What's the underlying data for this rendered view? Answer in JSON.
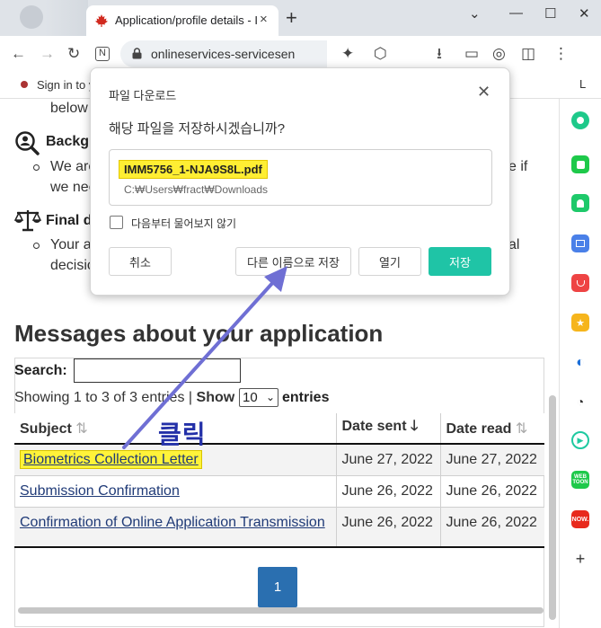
{
  "browser": {
    "tab_title": "Application/profile details - Imm",
    "tab_close": "×",
    "new_tab": "+",
    "url": "onlineservices-servicesen",
    "bookmark_label": "Sign in to y",
    "bookmark_end": "L",
    "window_controls": {
      "chevron": "⌄",
      "minimize": "—",
      "maximize": "☐",
      "close": "✕"
    },
    "toolbar_glyphs": {
      "back": "←",
      "forward": "→",
      "reload": "↻",
      "n_icon": "N",
      "share": "⇪",
      "ext1": "✦",
      "ext2": "⬡",
      "download": "⭳",
      "cast": "▭",
      "screenshot": "◎",
      "panel": "◫",
      "menu": "⋮"
    },
    "icons": [
      "red-maple-leaf-icon",
      "lock-icon",
      "ghost-bird-icon"
    ]
  },
  "page": {
    "partial_below": "below",
    "background_heading": "Backgr",
    "background_text_1": "We are",
    "background_text_1_end": "e if",
    "background_text_2": "we nee",
    "final_heading": "Final d",
    "final_text_1": "Your a",
    "final_text_1_end": "al",
    "final_text_2": "decisio",
    "messages_heading": "Messages about your application",
    "search_label": "Search:",
    "search_value": "",
    "showing_text": "Showing 1 to 3 of 3 entries |",
    "show_label": "Show",
    "show_value": "10",
    "entries_label": "entries",
    "columns": [
      "Subject",
      "Date sent",
      "Date read"
    ],
    "rows": [
      {
        "subject": "Biometrics Collection Letter",
        "date_sent": "June 27, 2022",
        "date_read": "June 27, 2022"
      },
      {
        "subject": "Submission Confirmation",
        "date_sent": "June 26, 2022",
        "date_read": "June 26, 2022"
      },
      {
        "subject": "Confirmation of Online Application Transmission",
        "date_sent": "June 26, 2022",
        "date_read": "June 26, 2022"
      }
    ],
    "page_number": "1"
  },
  "dialog": {
    "title": "파일 다운로드",
    "question": "해당 파일을 저장하시겠습니까?",
    "file_name": "IMM5756_1-NJA9S8L.pdf",
    "file_path": "C:₩Users₩fract₩Downloads",
    "checkbox_label": "다음부터 물어보지 않기",
    "checkbox_checked": false,
    "cancel": "취소",
    "save_as": "다른 이름으로 저장",
    "open": "열기",
    "save": "저장",
    "close_glyph": "✕"
  },
  "annotation": {
    "click_label": "클릭",
    "arrow_color": "#6f6fd4",
    "highlight_color": "#fff33a"
  },
  "sidepanel": {
    "icons": [
      "circle-green-icon",
      "chat-green-icon",
      "bell-green-icon",
      "calendar-blue-icon",
      "pocket-red-icon",
      "star-yellow-icon",
      "edge-icon",
      "shopping-bird-icon",
      "play-green-icon",
      "webtoon-icon",
      "now-red-icon",
      "add-icon"
    ],
    "labels": {
      "webtoon": "WEB TOON",
      "now": "NOW.",
      "add": "+"
    }
  },
  "colors": {
    "accent_teal": "#1fc4a6",
    "page_blue": "#2a6fb0",
    "link": "#1f3a77"
  }
}
